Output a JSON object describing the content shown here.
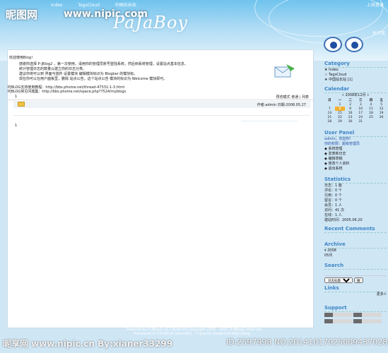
{
  "header": {
    "nav": [
      "Index",
      "TagsCloud",
      "中国站长站"
    ],
    "site_logo": "昵图网",
    "site_url": "www.nipic.com",
    "brand": "PaJaBoy",
    "login_link": "上线登录",
    "aboutme": "关于我"
  },
  "main": {
    "welcome_title": "欢迎使用Blog！",
    "welcome_lines": [
      "感谢你选择 P-JBlog2 ，第一次使用，请用你的管理员账号登陆系统，然后到系统管理，设置站点基本信息、",
      "统计管理日志的数量以建立你的日志分类。",
      "建议你将可以到 界面与插件·设置模块 编辑模块标识为 Blogber 的模块标。",
      "现在你可以在用户面板里，删除 站点公告，这个站点公告 模块的标识为 Welcome 模块即可。"
    ],
    "help_lines": [
      "PJBLOG支持使用教程：http://bbs.phome.net/thread-47531-1-3.html",
      "PJBLOG常见问题集：http://bbs.phome.net/space.php?7524/myblogs"
    ],
    "toolbar_num": "1",
    "toolbar_mode": "预览模式 普通 | 列表",
    "post_meta": "作者:admin 日期:2008.05.27",
    "page_num": "1"
  },
  "sidebar": {
    "category_title": "Category",
    "category_items": [
      "Index",
      "TagsCloud",
      "中国站长站 [1]"
    ],
    "calendar_title": "Calendar",
    "calendar_caption": "2008年12月",
    "calendar_headers": [
      "日",
      "一",
      "二",
      "三",
      "四",
      "五"
    ],
    "calendar_rows": [
      [
        "",
        "1",
        "2",
        "3",
        "4",
        "5"
      ],
      [
        "7",
        "8",
        "9",
        "10",
        "11",
        "12"
      ],
      [
        "14",
        "15",
        "16",
        "17",
        "18",
        "19"
      ],
      [
        "21",
        "22",
        "23",
        "24",
        "25",
        "26"
      ],
      [
        "28",
        "29",
        "30",
        "31",
        "",
        ""
      ]
    ],
    "userpanel_title": "User Panel",
    "userpanel_status": "admin，欢迎你!",
    "userpanel_role": "你的权限：超级管理员",
    "userpanel_items": [
      "系统管理",
      "发表新日志",
      "编辑草稿",
      "修改个人资料",
      "退出系统"
    ],
    "statistics_title": "Statistics",
    "statistics_lines": [
      "日志：1 篇",
      "评论：0 个",
      "引用：0 个",
      "留言：0 个",
      "会员：1 人",
      "访问：41 次",
      "在线：1 人",
      "建站时间：2005.06.20"
    ],
    "recent_comments_title": "Recent Comments",
    "archive_title": "Archive",
    "archive_items": [
      "2008",
      "05月"
    ],
    "search_title": "Search",
    "search_scope": "日志标题",
    "search_button": "搜",
    "links_title": "Links",
    "links_more": "更多>",
    "support_title": "Support"
  },
  "footer": {
    "line1": "Powered by P-JBlog2 v2.7 Build 05 Copyright 2005 - 2007, P-JBlog2 ofenl css",
    "line2": "Processed in 0.078125 second(s) , 7 queries    Subjected http://blog ..."
  },
  "watermark": {
    "text": "昵享网 www.nipic.cn",
    "user": "By:xianer33299",
    "id": "ID:2597998 NO:20141017025009437028"
  }
}
